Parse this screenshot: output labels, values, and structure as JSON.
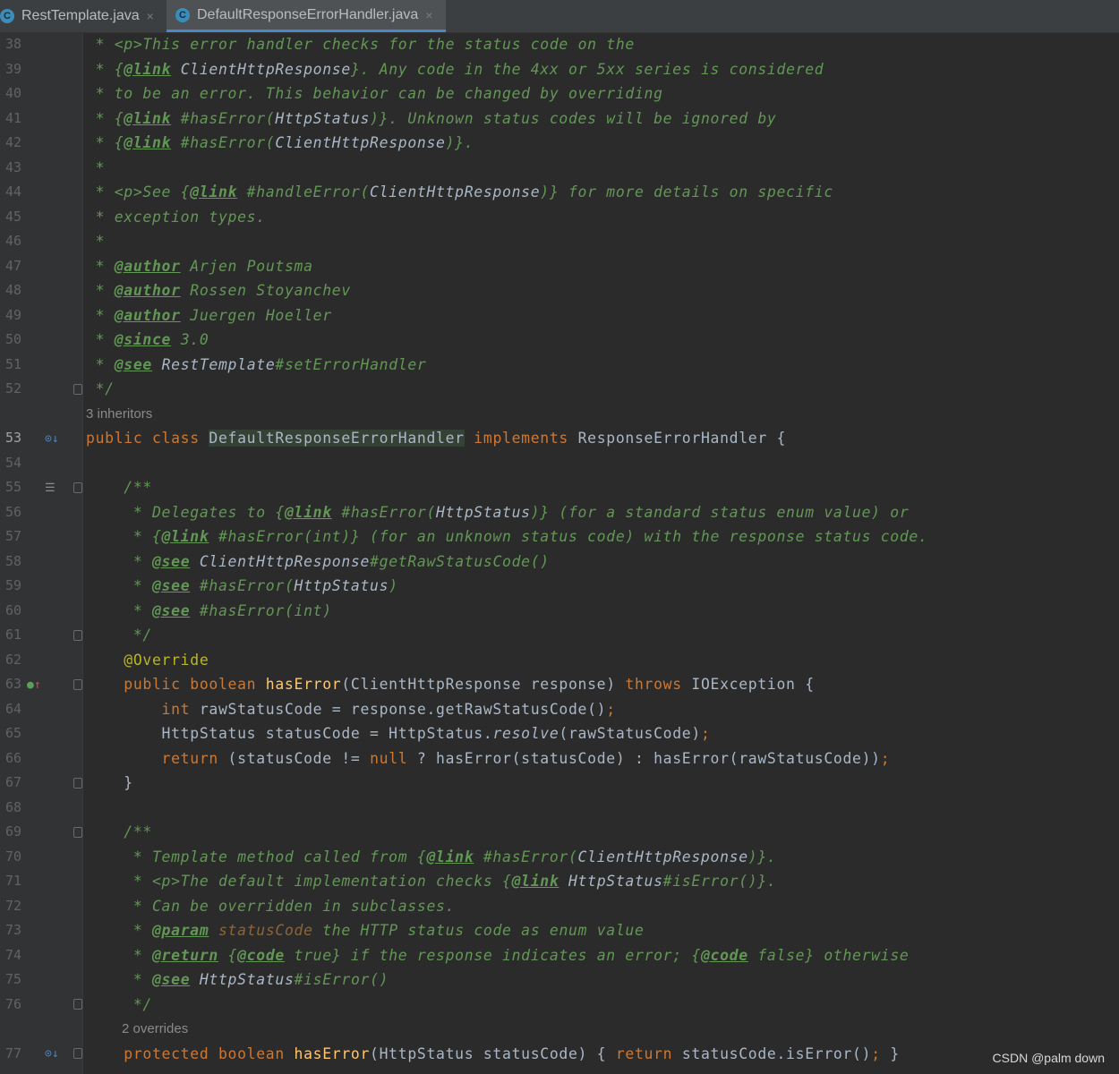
{
  "tabs": [
    {
      "icon": "class-icon",
      "letter": "C",
      "label": "RestTemplate.java",
      "close": "×"
    },
    {
      "icon": "class-icon",
      "letter": "C",
      "label": "DefaultResponseErrorHandler.java",
      "close": "×"
    }
  ],
  "hints": {
    "inheritors": "3 inheritors",
    "overrides": "2 overrides"
  },
  "lines": [
    {
      "n": "38",
      "segs": [
        [
          "doc",
          " * "
        ],
        [
          "doc",
          "<p>"
        ],
        [
          "doc",
          "This error handler checks for the status code on the"
        ]
      ]
    },
    {
      "n": "39",
      "segs": [
        [
          "doc",
          " * {"
        ],
        [
          "tag",
          "@link"
        ],
        [
          "doc",
          " "
        ],
        [
          "dcls",
          "ClientHttpResponse"
        ],
        [
          "doc",
          "}. Any code in the 4xx or 5xx series is considered"
        ]
      ]
    },
    {
      "n": "40",
      "segs": [
        [
          "doc",
          " * to be an error. This behavior can be changed by overriding"
        ]
      ]
    },
    {
      "n": "41",
      "segs": [
        [
          "doc",
          " * {"
        ],
        [
          "tag",
          "@link"
        ],
        [
          "doc",
          " #hasError("
        ],
        [
          "dcls",
          "HttpStatus"
        ],
        [
          "doc",
          ")}. Unknown status codes will be ignored by"
        ]
      ]
    },
    {
      "n": "42",
      "segs": [
        [
          "doc",
          " * {"
        ],
        [
          "tag",
          "@link"
        ],
        [
          "doc",
          " #hasError("
        ],
        [
          "dcls",
          "ClientHttpResponse"
        ],
        [
          "doc",
          ")}."
        ]
      ]
    },
    {
      "n": "43",
      "segs": [
        [
          "doc",
          " *"
        ]
      ]
    },
    {
      "n": "44",
      "segs": [
        [
          "doc",
          " * <p>See {"
        ],
        [
          "tag",
          "@link"
        ],
        [
          "doc",
          " #handleError("
        ],
        [
          "dcls",
          "ClientHttpResponse"
        ],
        [
          "doc",
          ")} for more details on specific"
        ]
      ]
    },
    {
      "n": "45",
      "segs": [
        [
          "doc",
          " * exception types."
        ]
      ]
    },
    {
      "n": "46",
      "segs": [
        [
          "doc",
          " *"
        ]
      ]
    },
    {
      "n": "47",
      "segs": [
        [
          "doc",
          " * "
        ],
        [
          "tag",
          "@author"
        ],
        [
          "doc",
          " Arjen Poutsma"
        ]
      ]
    },
    {
      "n": "48",
      "segs": [
        [
          "doc",
          " * "
        ],
        [
          "tag",
          "@author"
        ],
        [
          "doc",
          " Rossen Stoyanchev"
        ]
      ]
    },
    {
      "n": "49",
      "segs": [
        [
          "doc",
          " * "
        ],
        [
          "tag",
          "@author"
        ],
        [
          "doc",
          " Juergen Hoeller"
        ]
      ]
    },
    {
      "n": "50",
      "segs": [
        [
          "doc",
          " * "
        ],
        [
          "tag",
          "@since"
        ],
        [
          "doc",
          " 3.0"
        ]
      ]
    },
    {
      "n": "51",
      "segs": [
        [
          "doc",
          " * "
        ],
        [
          "tag",
          "@see"
        ],
        [
          "doc",
          " "
        ],
        [
          "dcls",
          "RestTemplate"
        ],
        [
          "doc",
          "#setErrorHandler"
        ]
      ]
    },
    {
      "n": "52",
      "segs": [
        [
          "doc",
          " */"
        ]
      ]
    },
    {
      "n": "53",
      "segs": [
        [
          "kw",
          "public class "
        ],
        [
          "hl",
          "DefaultResponseErrorHandler"
        ],
        [
          "kw",
          " implements "
        ],
        [
          "plain",
          "ResponseErrorHandler {"
        ]
      ]
    },
    {
      "n": "54",
      "segs": []
    },
    {
      "n": "55",
      "segs": [
        [
          "doc",
          "    /**"
        ]
      ]
    },
    {
      "n": "56",
      "segs": [
        [
          "doc",
          "     * Delegates to {"
        ],
        [
          "tag",
          "@link"
        ],
        [
          "doc",
          " #hasError("
        ],
        [
          "dcls",
          "HttpStatus"
        ],
        [
          "doc",
          ")} (for a standard status enum value) or"
        ]
      ]
    },
    {
      "n": "57",
      "segs": [
        [
          "doc",
          "     * {"
        ],
        [
          "tag",
          "@link"
        ],
        [
          "doc",
          " #hasError(int)} (for an unknown status code) with the response status code."
        ]
      ]
    },
    {
      "n": "58",
      "segs": [
        [
          "doc",
          "     * "
        ],
        [
          "tag",
          "@see"
        ],
        [
          "doc",
          " "
        ],
        [
          "dcls",
          "ClientHttpResponse"
        ],
        [
          "doc",
          "#getRawStatusCode()"
        ]
      ]
    },
    {
      "n": "59",
      "segs": [
        [
          "doc",
          "     * "
        ],
        [
          "tag",
          "@see"
        ],
        [
          "doc",
          " #hasError("
        ],
        [
          "dcls",
          "HttpStatus"
        ],
        [
          "doc",
          ")"
        ]
      ]
    },
    {
      "n": "60",
      "segs": [
        [
          "doc",
          "     * "
        ],
        [
          "tag",
          "@see"
        ],
        [
          "doc",
          " #hasError(int)"
        ]
      ]
    },
    {
      "n": "61",
      "segs": [
        [
          "doc",
          "     */"
        ]
      ]
    },
    {
      "n": "62",
      "segs": [
        [
          "ann",
          "    @Override"
        ]
      ]
    },
    {
      "n": "63",
      "segs": [
        [
          "kw",
          "    public boolean "
        ],
        [
          "fn",
          "hasError"
        ],
        [
          "plain",
          "(ClientHttpResponse response) "
        ],
        [
          "kw",
          "throws "
        ],
        [
          "plain",
          "IOException {"
        ]
      ]
    },
    {
      "n": "64",
      "segs": [
        [
          "kw",
          "        int "
        ],
        [
          "plain",
          "rawStatusCode = response.getRawStatusCode()"
        ],
        [
          "kw",
          ";"
        ]
      ]
    },
    {
      "n": "65",
      "segs": [
        [
          "plain",
          "        HttpStatus statusCode = HttpStatus."
        ],
        [
          "st",
          "resolve"
        ],
        [
          "plain",
          "(rawStatusCode)"
        ],
        [
          "kw",
          ";"
        ]
      ]
    },
    {
      "n": "66",
      "segs": [
        [
          "kw",
          "        return "
        ],
        [
          "plain",
          "(statusCode != "
        ],
        [
          "kw",
          "null "
        ],
        [
          "plain",
          "? hasError(statusCode) : hasError(rawStatusCode))"
        ],
        [
          "kw",
          ";"
        ]
      ]
    },
    {
      "n": "67",
      "segs": [
        [
          "plain",
          "    }"
        ]
      ]
    },
    {
      "n": "68",
      "segs": []
    },
    {
      "n": "69",
      "segs": [
        [
          "doc",
          "    /**"
        ]
      ]
    },
    {
      "n": "70",
      "segs": [
        [
          "doc",
          "     * Template method called from {"
        ],
        [
          "tag",
          "@link"
        ],
        [
          "doc",
          " #hasError("
        ],
        [
          "dcls",
          "ClientHttpResponse"
        ],
        [
          "doc",
          ")}."
        ]
      ]
    },
    {
      "n": "71",
      "segs": [
        [
          "doc",
          "     * <p>The default implementation checks {"
        ],
        [
          "tag",
          "@link"
        ],
        [
          "doc",
          " "
        ],
        [
          "dcls",
          "HttpStatus"
        ],
        [
          "doc",
          "#isError()}."
        ]
      ]
    },
    {
      "n": "72",
      "segs": [
        [
          "doc",
          "     * Can be overridden in subclasses."
        ]
      ]
    },
    {
      "n": "73",
      "segs": [
        [
          "doc",
          "     * "
        ],
        [
          "tag",
          "@param"
        ],
        [
          "doc",
          " "
        ],
        [
          "dparam",
          "statusCode"
        ],
        [
          "doc",
          " the HTTP status code as enum value"
        ]
      ]
    },
    {
      "n": "74",
      "segs": [
        [
          "doc",
          "     * "
        ],
        [
          "tag",
          "@return"
        ],
        [
          "doc",
          " {"
        ],
        [
          "tag",
          "@code"
        ],
        [
          "doc",
          " true} if the response indicates an error; {"
        ],
        [
          "tag",
          "@code"
        ],
        [
          "doc",
          " false} otherwise"
        ]
      ]
    },
    {
      "n": "75",
      "segs": [
        [
          "doc",
          "     * "
        ],
        [
          "tag",
          "@see"
        ],
        [
          "doc",
          " "
        ],
        [
          "dcls",
          "HttpStatus"
        ],
        [
          "doc",
          "#isError()"
        ]
      ]
    },
    {
      "n": "76",
      "segs": [
        [
          "doc",
          "     */"
        ]
      ]
    },
    {
      "n": "77",
      "segs": [
        [
          "kw",
          "    protected boolean "
        ],
        [
          "fn",
          "hasError"
        ],
        [
          "plain",
          "(HttpStatus statusCode) { "
        ],
        [
          "kw",
          "return "
        ],
        [
          "plain",
          "statusCode.isError()"
        ],
        [
          "kw",
          ";"
        ],
        [
          "plain",
          " }"
        ]
      ]
    }
  ],
  "watermark": "CSDN @palm down",
  "colors": {
    "keyword": "#cc7832",
    "doc": "#629755",
    "method": "#ffc66d",
    "annotation": "#bbb529",
    "text": "#a9b7c6",
    "background": "#2b2b2b"
  }
}
